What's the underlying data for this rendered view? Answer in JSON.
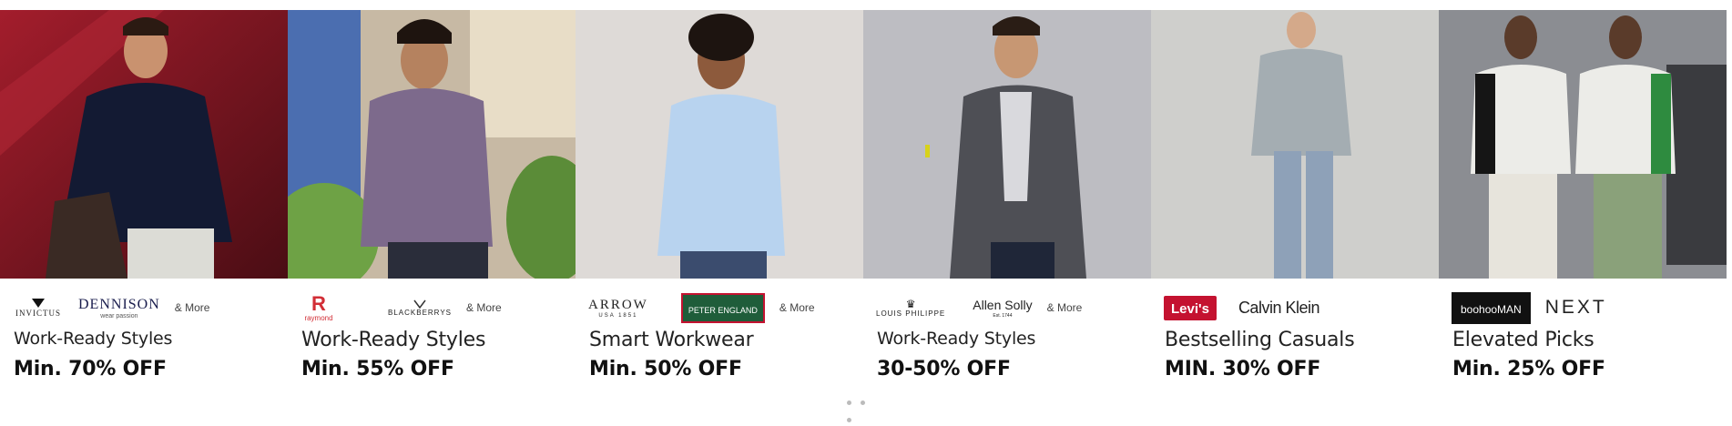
{
  "cards": [
    {
      "brands": [
        "INVICTUS",
        "DENNISON"
      ],
      "brand_taglines": [
        "",
        "wear passion"
      ],
      "more": "& More",
      "title": "Work-Ready Styles",
      "offer": "Min. 70% OFF",
      "bg": "#7a1a24"
    },
    {
      "brands": [
        "raymond",
        "BLACKBERRYS"
      ],
      "more": "& More",
      "title": "Work-Ready Styles",
      "offer": "Min. 55% OFF",
      "bg": "#6b7aa3"
    },
    {
      "brands": [
        "ARROW",
        "PETER ENGLAND"
      ],
      "brand_taglines": [
        "USA 1851",
        ""
      ],
      "more": "& More",
      "title": "Smart Workwear",
      "offer": "Min. 50% OFF",
      "bg": "#d9d6d4"
    },
    {
      "brands": [
        "LOUIS PHILIPPE",
        "Allen Solly"
      ],
      "brand_taglines": [
        "",
        "Est. 1744"
      ],
      "more": "& More",
      "title": "Work-Ready Styles",
      "offer": "30-50% OFF",
      "bg": "#b8b8bd"
    },
    {
      "brands": [
        "Levi's",
        "Calvin Klein"
      ],
      "title": "Bestselling Casuals",
      "offer": "MIN. 30% OFF",
      "bg": "#c9c9c6"
    },
    {
      "brands": [
        "boohooMAN",
        "NEXT"
      ],
      "title": "Elevated Picks",
      "offer": "Min. 25% OFF",
      "bg": "#8d8f94"
    }
  ],
  "colors": {
    "raymond_red": "#d22e36",
    "peter_england_green": "#1f5d3a",
    "levis_red": "#c41230",
    "boohoo_black": "#111111"
  }
}
